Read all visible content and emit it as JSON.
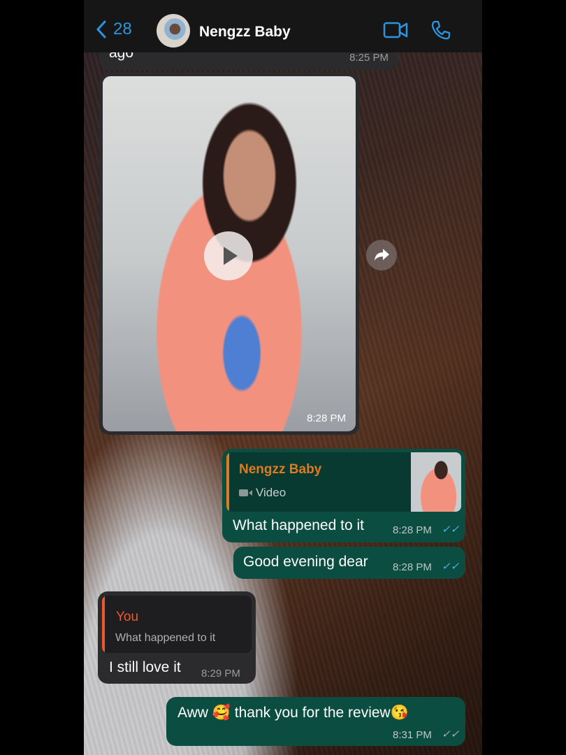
{
  "header": {
    "back_count": "28",
    "contact_name": "Nengzz Baby",
    "icons": [
      "chevron-left-icon",
      "video-call-icon",
      "phone-icon"
    ],
    "accent": "#2a95e0"
  },
  "messages": [
    {
      "type": "text",
      "direction": "in",
      "partial_text": "ago",
      "time": "8:25 PM"
    },
    {
      "type": "video",
      "direction": "in",
      "time": "8:28 PM",
      "icons": [
        "play-icon",
        "forward-icon"
      ]
    },
    {
      "type": "reply",
      "direction": "out",
      "quoted_author": "Nengzz Baby",
      "quoted_label": "Video",
      "text": "What happened to it",
      "time": "8:28 PM",
      "status": "read"
    },
    {
      "type": "text",
      "direction": "out",
      "text": "Good evening dear",
      "time": "8:28 PM",
      "status": "read"
    },
    {
      "type": "reply",
      "direction": "in",
      "quoted_author": "You",
      "quoted_text": "What happened to it",
      "text": "I still love it",
      "time": "8:29 PM"
    },
    {
      "type": "text",
      "direction": "out",
      "text": "Aww 🥰 thank you for the review😘",
      "time": "8:31 PM",
      "status": "delivered"
    }
  ],
  "colors": {
    "outgoing": "#0c4d42",
    "incoming": "#2b2b2d",
    "quote_author": "#e07a1f",
    "read_ticks": "#4fb3f6"
  }
}
